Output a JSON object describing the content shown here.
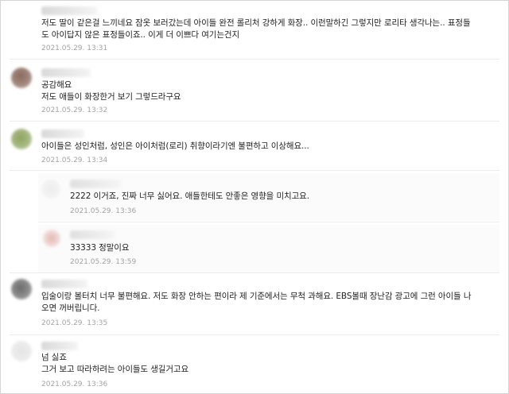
{
  "comments": [
    {
      "lines": [
        "저도 딸이 같은걸 느끼네요 잠옷 보러갔는데 아이들 완전 롤리처 강하게 화장.. 이런말하긴 그렇지만 로리타 생각나는.. 표정들",
        "도 아이답지 않은 표정들이죠.. 이게 더 이쁘다 여기는건지"
      ],
      "timestamp": "2021.05.29. 13:31"
    },
    {
      "lines": [
        "공감해요",
        "저도 애들이 화장한거 보기 그렇드라구요"
      ],
      "timestamp": "2021.05.29. 13:32"
    },
    {
      "lines": [
        "아이들은 성인처럼, 성인은 아이처럼(로리) 취향이라기엔 불편하고 이상해요..."
      ],
      "timestamp": "2021.05.29. 13:34"
    },
    {
      "lines": [
        "2222 이거죠, 진짜 너무 싫어요. 애들한테도 안좋은 영향을 미치고요."
      ],
      "timestamp": "2021.05.29. 13:36"
    },
    {
      "lines": [
        "33333 정말이요"
      ],
      "timestamp": "2021.05.29. 13:59"
    },
    {
      "lines": [
        "입술이랑 볼터치 너무 불편해요. 저도 화장 안하는 편이라 제 기준에서는 무척 과해요. EBS볼때 장난감 광고에 그런 아이들 나",
        "오면 꺼버립니다."
      ],
      "timestamp": "2021.05.29. 13:35"
    },
    {
      "lines": [
        "넘 싫죠",
        "그거 보고 따라하려는 아이들도 생길거고요"
      ],
      "timestamp": "2021.05.29. 13:36"
    }
  ],
  "colors": {
    "timestamp": "#a3a3a3",
    "text": "#222222",
    "divider": "#ececec"
  }
}
